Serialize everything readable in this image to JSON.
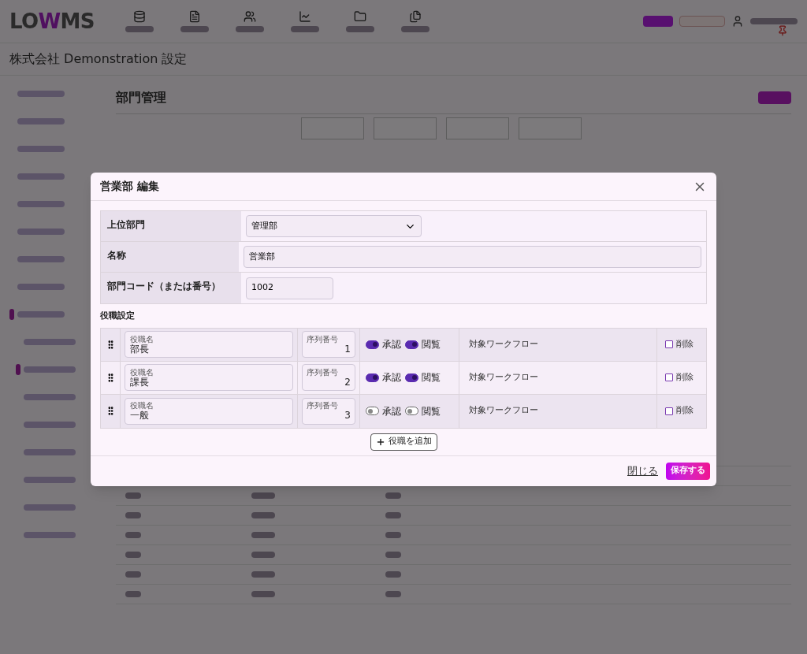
{
  "header": {
    "logo": {
      "prefix": "LO",
      "mark": "W",
      "suffix": "MS"
    }
  },
  "page_title": "株式会社 Demonstration 設定",
  "sidebar_items": [
    {
      "selected": false
    },
    {
      "selected": false
    },
    {
      "selected": false
    },
    {
      "selected": false
    },
    {
      "selected": false
    },
    {
      "selected": false
    },
    {
      "selected": false
    },
    {
      "selected": false
    },
    {
      "selected": true,
      "children": [
        {
          "selected": false
        },
        {
          "selected": true
        },
        {
          "selected": false
        },
        {
          "selected": false
        },
        {
          "selected": false
        },
        {
          "selected": false
        },
        {
          "selected": false
        },
        {
          "selected": false
        }
      ]
    }
  ],
  "section_title": "部門管理",
  "modal": {
    "title": "営業部 編集",
    "fields": [
      {
        "kind": "select",
        "label": "上位部門",
        "value": "管理部"
      },
      {
        "kind": "wide",
        "label": "名称",
        "value": "営業部"
      },
      {
        "kind": "short",
        "label": "部門コード（または番号）",
        "value": "1002"
      }
    ],
    "roles_heading": "役職設定",
    "roles": [
      {
        "name_label": "役職名",
        "name": "部長",
        "order_label": "序列番号",
        "order": "1",
        "approve": {
          "label": "承認",
          "on": true
        },
        "view": {
          "label": "閲覧",
          "on": true
        },
        "workflow": "対象ワークフロー",
        "delete": {
          "label": "削除",
          "checked": false
        }
      },
      {
        "name_label": "役職名",
        "name": "課長",
        "order_label": "序列番号",
        "order": "2",
        "approve": {
          "label": "承認",
          "on": true
        },
        "view": {
          "label": "閲覧",
          "on": true
        },
        "workflow": "対象ワークフロー",
        "delete": {
          "label": "削除",
          "checked": false
        }
      },
      {
        "name_label": "役職名",
        "name": "一般",
        "order_label": "序列番号",
        "order": "3",
        "approve": {
          "label": "承認",
          "on": false
        },
        "view": {
          "label": "閲覧",
          "on": false
        },
        "workflow": "対象ワークフロー",
        "delete": {
          "label": "削除",
          "checked": false
        }
      }
    ],
    "add_button": "役職を追加",
    "close_link": "閉じる",
    "save_button": "保存する"
  }
}
